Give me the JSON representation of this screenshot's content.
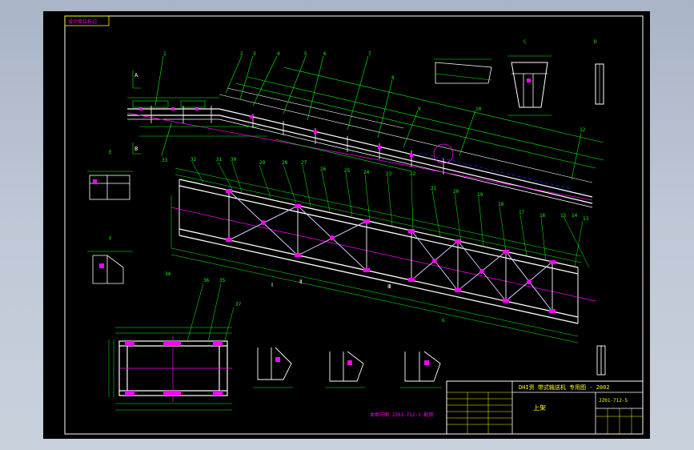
{
  "title_block": {
    "stamp": "设计单位标记",
    "project": "DHI资 带式输送机 专用图 - 2002",
    "drawing_no": "JZ01-712-5",
    "part_name": "上架",
    "note": "本图与图 JZ01-712-1  配用"
  },
  "leader_numbers": {
    "top": [
      "1",
      "2",
      "3",
      "4",
      "5",
      "6",
      "7",
      "8",
      "9",
      "10",
      "11",
      "12",
      "33"
    ],
    "middle": [
      "32",
      "31",
      "30",
      "29",
      "28",
      "27",
      "26",
      "25",
      "24",
      "23",
      "22",
      "21",
      "20",
      "19",
      "18",
      "17",
      "16",
      "15",
      "14",
      "13"
    ],
    "lower": [
      "34",
      "36",
      "35",
      "38",
      "37"
    ]
  },
  "section_markers": {
    "top_views": [
      "Ⅰ",
      "Ⅱ",
      "Ⅲ"
    ],
    "detail_marks": [
      "A",
      "B",
      "C",
      "D",
      "E",
      "F",
      "G"
    ]
  },
  "colors": {
    "background": "#000000",
    "frame": "#ffffff",
    "geometry": "#ffffff",
    "dimension": "#00ff00",
    "centerline": "#ff00ff",
    "hidden": "#0000ff",
    "highlight": "#ffff00"
  }
}
